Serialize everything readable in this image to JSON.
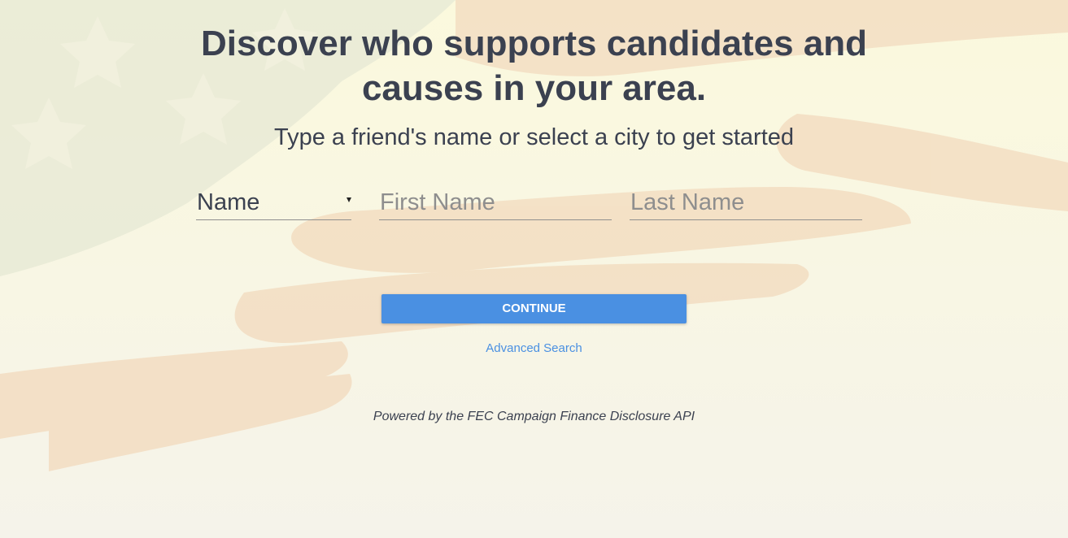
{
  "hero": {
    "headline_line1": "Discover who supports candidates and",
    "headline_line2": "causes in your area.",
    "subheadline": "Type a friend's name or select a city to get started"
  },
  "search_form": {
    "search_type": {
      "selected": "Name",
      "icon": "caret-down-icon"
    },
    "first_name": {
      "value": "",
      "placeholder": "First Name"
    },
    "last_name": {
      "value": "",
      "placeholder": "Last Name"
    },
    "continue_label": "CONTINUE",
    "advanced_search_label": "Advanced Search"
  },
  "footer": {
    "attribution": "Powered by the FEC Campaign Finance Disclosure API"
  },
  "colors": {
    "accent": "#4a90e2",
    "text": "#3b4150",
    "background": "#f7f5e6"
  }
}
